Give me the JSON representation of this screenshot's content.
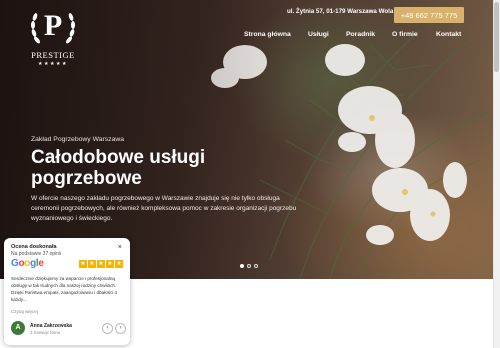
{
  "logo": {
    "letter": "P",
    "name": "PRESTIGE",
    "stars": "★★★★★"
  },
  "topbar": {
    "address": "ul. Żytnia 57, 01-179 Warszawa Wola",
    "phone": "+48 662 775 775"
  },
  "nav": {
    "items": [
      {
        "label": "Strona główna"
      },
      {
        "label": "Usługi"
      },
      {
        "label": "Poradnik"
      },
      {
        "label": "O firmie"
      },
      {
        "label": "Kontakt"
      }
    ]
  },
  "hero": {
    "subtitle": "Zakład Pogrzebowy Warszawa",
    "title": "Całodobowe usługi pogrzebowe",
    "description": "W ofercie naszego zakładu pogrzebowego w Warszawie znajduje się nie tylko obsługa ceremonii pogrzebowych, ale również kompleksowa pomoc w zakresie organizacji pogrzebu wyznaniowego i świeckiego.",
    "slides": 3,
    "active_slide": 1
  },
  "review_widget": {
    "heading": "Ocena doskonała",
    "count": "Na podstawie 37 opinii",
    "close": "×",
    "google": "Google",
    "rating": 5,
    "text": "Serdecznie dziękujemy za wsparcie i profesjonalną obsługę w tak trudnych dla naszej rodziny chwilach. Dzięki Państwa empatii, zaangażowaniu i dbałości o każdy...",
    "more": "Czytaj więcej",
    "author_initial": "A",
    "author": "Anna Zakrzewska",
    "time": "1 miesiąc temu",
    "prev": "‹",
    "next": "›"
  },
  "colors": {
    "accent": "#d8b26a",
    "google_star": "#f4b400",
    "avatar": "#3e7a3a"
  }
}
